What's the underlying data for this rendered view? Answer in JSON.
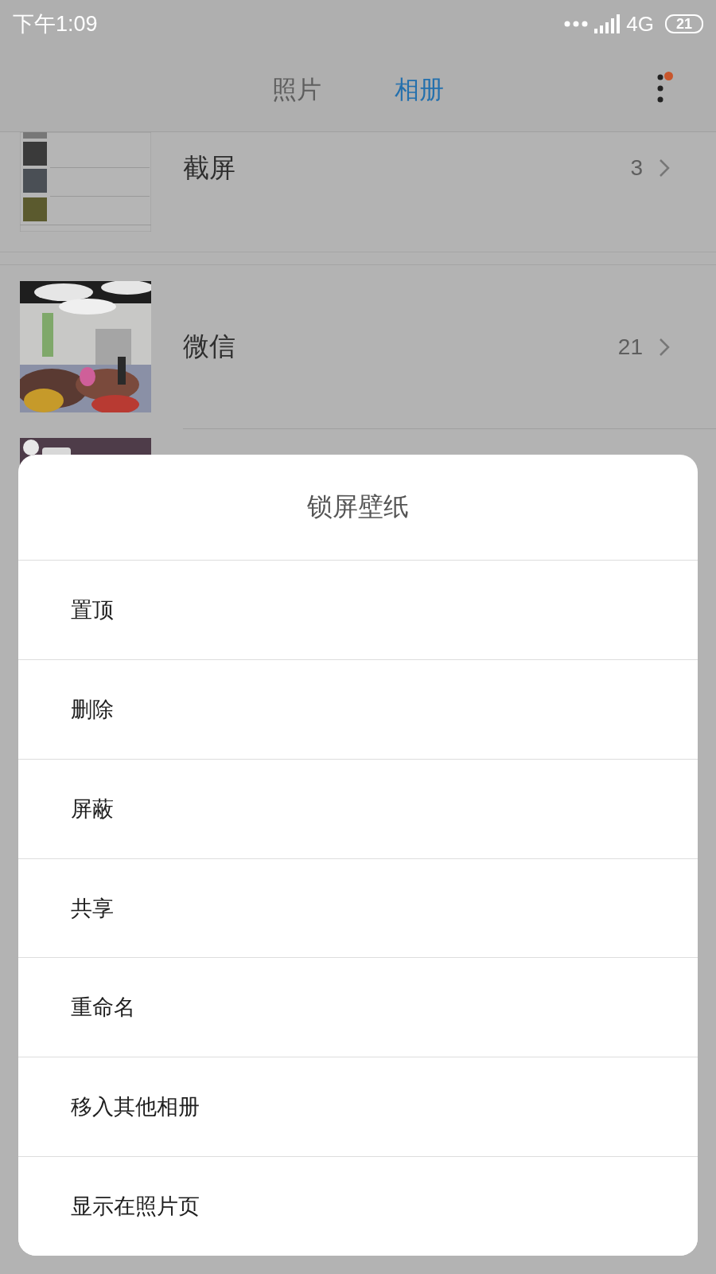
{
  "status_bar": {
    "time": "下午1:09",
    "network": "4G",
    "battery": "21"
  },
  "tabs": [
    {
      "label": "照片",
      "selected": false
    },
    {
      "label": "相册",
      "selected": true
    }
  ],
  "menu": {
    "badge": true
  },
  "albums": [
    {
      "kind": "screenshot",
      "name": "截屏",
      "count": "3"
    },
    {
      "name": "微信",
      "count": "21"
    },
    {
      "kind": "chat"
    }
  ],
  "sheet": {
    "title": "锁屏壁纸",
    "options": [
      "置顶",
      "删除",
      "屏蔽",
      "共享",
      "重命名",
      "移入其他相册",
      "显示在照片页"
    ]
  }
}
